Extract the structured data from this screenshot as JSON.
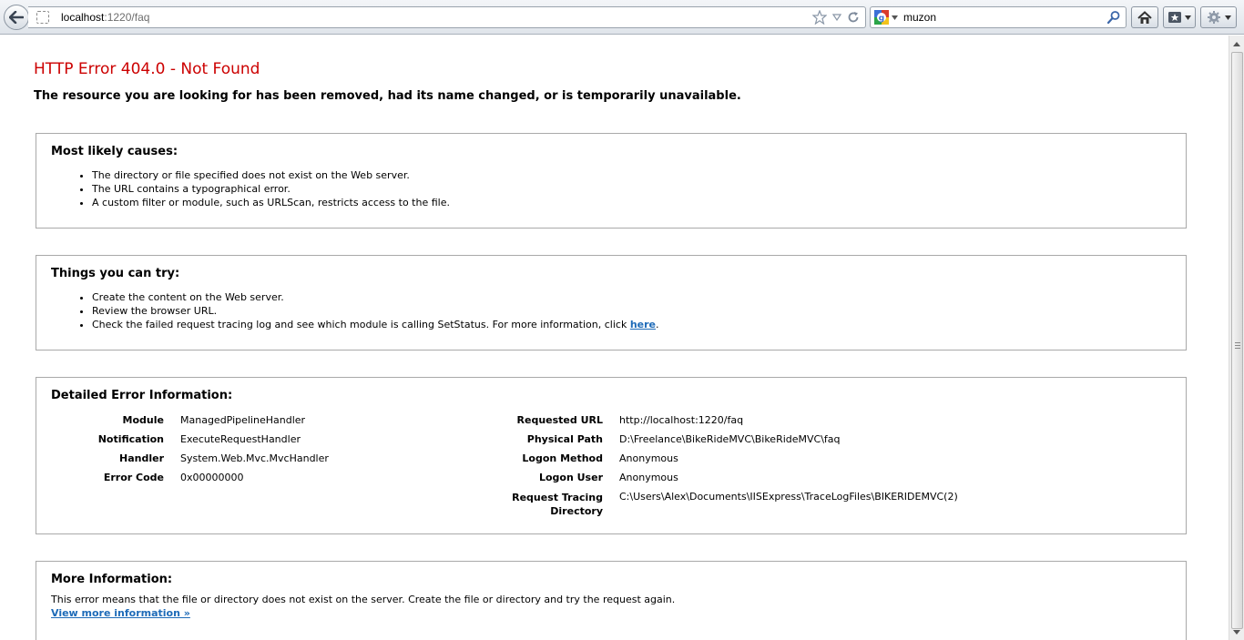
{
  "browser": {
    "url_host": "localhost",
    "url_path": ":1220/faq",
    "search_query": "muzon"
  },
  "error": {
    "title": "HTTP Error 404.0 - Not Found",
    "subtitle": "The resource you are looking for has been removed, had its name changed, or is temporarily unavailable."
  },
  "causes": {
    "heading": "Most likely causes:",
    "items": [
      "The directory or file specified does not exist on the Web server.",
      "The URL contains a typographical error.",
      "A custom filter or module, such as URLScan, restricts access to the file."
    ]
  },
  "try": {
    "heading": "Things you can try:",
    "items": [
      "Create the content on the Web server.",
      "Review the browser URL.",
      "Check the failed request tracing log and see which module is calling SetStatus. For more information, click "
    ],
    "link": "here",
    "link_suffix": "."
  },
  "details": {
    "heading": "Detailed Error Information:",
    "left": [
      {
        "label": "Module",
        "value": "ManagedPipelineHandler"
      },
      {
        "label": "Notification",
        "value": "ExecuteRequestHandler"
      },
      {
        "label": "Handler",
        "value": "System.Web.Mvc.MvcHandler"
      },
      {
        "label": "Error Code",
        "value": "0x00000000"
      }
    ],
    "right": [
      {
        "label": "Requested URL",
        "value": "http://localhost:1220/faq"
      },
      {
        "label": "Physical Path",
        "value": "D:\\Freelance\\BikeRideMVC\\BikeRideMVC\\faq"
      },
      {
        "label": "Logon Method",
        "value": "Anonymous"
      },
      {
        "label": "Logon User",
        "value": "Anonymous"
      },
      {
        "label": "Request Tracing",
        "label2": "Directory",
        "value": "C:\\Users\\Alex\\Documents\\IISExpress\\TraceLogFiles\\BIKERIDEMVC(2)"
      }
    ]
  },
  "more": {
    "heading": "More Information:",
    "text": "This error means that the file or directory does not exist on the server. Create the file or directory and try the request again.",
    "link": "View more information »"
  }
}
